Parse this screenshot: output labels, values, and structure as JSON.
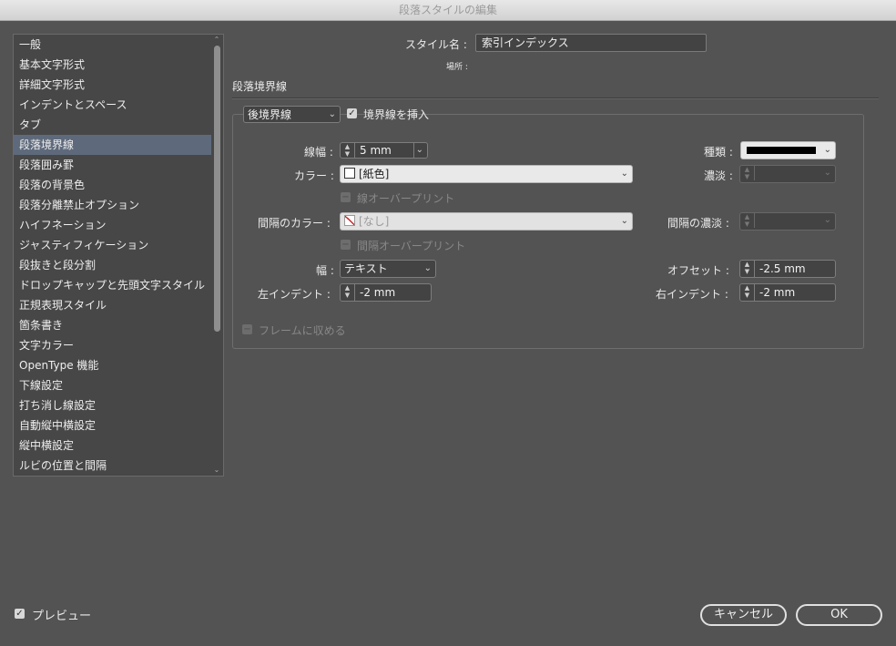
{
  "window": {
    "title": "段落スタイルの編集"
  },
  "sidebar": {
    "items": [
      {
        "label": "一般"
      },
      {
        "label": "基本文字形式"
      },
      {
        "label": "詳細文字形式"
      },
      {
        "label": "インデントとスペース"
      },
      {
        "label": "タブ"
      },
      {
        "label": "段落境界線",
        "selected": true
      },
      {
        "label": "段落囲み罫"
      },
      {
        "label": "段落の背景色"
      },
      {
        "label": "段落分離禁止オプション"
      },
      {
        "label": "ハイフネーション"
      },
      {
        "label": "ジャスティフィケーション"
      },
      {
        "label": "段抜きと段分割"
      },
      {
        "label": "ドロップキャップと先頭文字スタイル"
      },
      {
        "label": "正規表現スタイル"
      },
      {
        "label": "箇条書き"
      },
      {
        "label": "文字カラー"
      },
      {
        "label": "OpenType 機能"
      },
      {
        "label": "下線設定"
      },
      {
        "label": "打ち消し線設定"
      },
      {
        "label": "自動縦中横設定"
      },
      {
        "label": "縦中横設定"
      },
      {
        "label": "ルビの位置と間隔"
      }
    ]
  },
  "header": {
    "style_name_label": "スタイル名 :",
    "style_name_value": "索引インデックス",
    "location_label": "場所 :"
  },
  "section": {
    "title": "段落境界線"
  },
  "rule": {
    "position_value": "後境界線",
    "insert_rule_label": "境界線を挿入",
    "insert_rule_checked": true,
    "weight_label": "線幅 :",
    "weight_value": "5 mm",
    "type_label": "種類 :",
    "color_label": "カラー :",
    "color_value": "[紙色]",
    "tint_label": "濃淡 :",
    "overprint_label": "線オーバープリント",
    "gap_color_label": "間隔のカラー :",
    "gap_color_value": "[なし]",
    "gap_tint_label": "間隔の濃淡 :",
    "gap_overprint_label": "間隔オーバープリント",
    "width_label": "幅 :",
    "width_value": "テキスト",
    "offset_label": "オフセット :",
    "offset_value": "-2.5 mm",
    "left_indent_label": "左インデント :",
    "left_indent_value": "-2 mm",
    "right_indent_label": "右インデント :",
    "right_indent_value": "-2 mm",
    "keep_in_frame_label": "フレームに収める"
  },
  "footer": {
    "preview_label": "プレビュー",
    "preview_checked": true,
    "cancel_label": "キャンセル",
    "ok_label": "OK"
  },
  "colors": {
    "selection": "#5e6a7c",
    "background": "#535353",
    "swatch_none_stroke": "#c4282c"
  }
}
